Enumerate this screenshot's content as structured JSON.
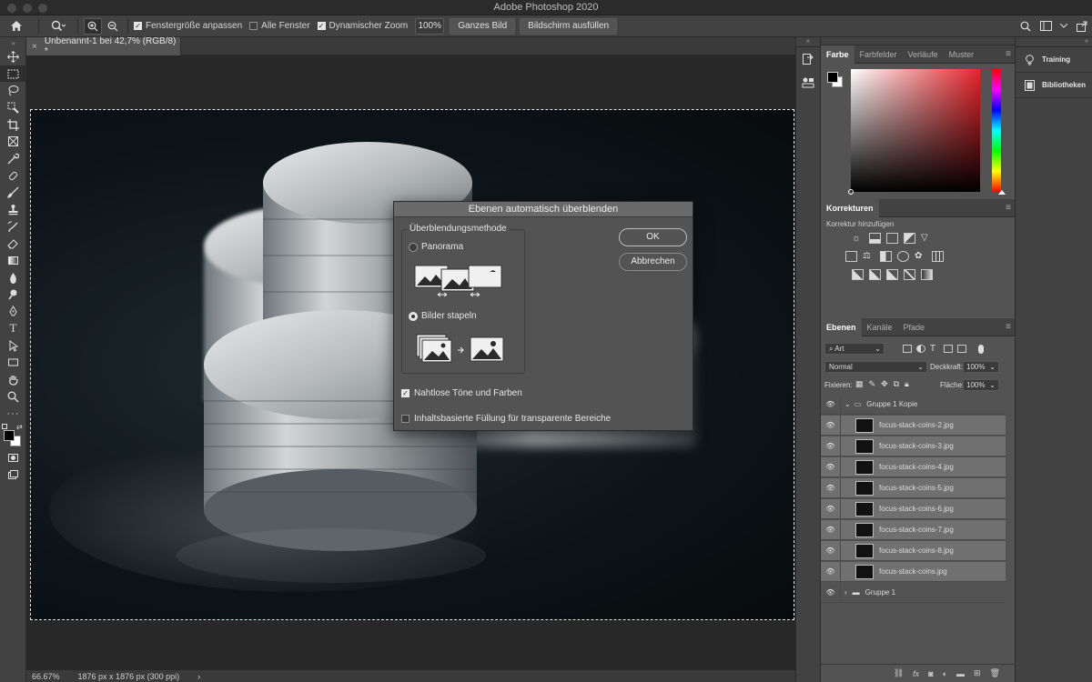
{
  "window": {
    "title": "Adobe Photoshop 2020"
  },
  "options": {
    "fit_window_label": "Fenstergröße anpassen",
    "all_windows_label": "Alle Fenster",
    "dynamic_zoom_label": "Dynamischer Zoom",
    "zoom_value": "100%",
    "whole_image_label": "Ganzes Bild",
    "fill_screen_label": "Bildschirm ausfüllen"
  },
  "document": {
    "tab_title": "Unbenannt-1 bei 42,7% (RGB/8) *",
    "status_zoom": "66.67%",
    "status_info": "1876 px x 1876 px (300 ppi)"
  },
  "dialog": {
    "title": "Ebenen automatisch überblenden",
    "group_label": "Überblendungsmethode",
    "option_panorama": "Panorama",
    "option_stack": "Bilder stapeln",
    "selected": "Bilder stapeln",
    "ok_label": "OK",
    "cancel_label": "Abbrechen",
    "seamless_label": "Nahtlose Töne und Farben",
    "seamless_checked": true,
    "content_aware_label": "Inhaltsbasierte Füllung für transparente Bereiche",
    "content_aware_checked": false
  },
  "color_panel": {
    "tabs": [
      "Farbe",
      "Farbfelder",
      "Verläufe",
      "Muster"
    ],
    "foreground": "#000000",
    "background": "#ffffff",
    "hue_color": "#e7242b"
  },
  "adjustments_panel": {
    "tab": "Korrekturen",
    "label": "Korrektur hinzufügen"
  },
  "layers_panel": {
    "tabs": [
      "Ebenen",
      "Kanäle",
      "Pfade"
    ],
    "filter_label": "Art",
    "blend_mode": "Normal",
    "opacity_label": "Deckkraft:",
    "opacity_value": "100%",
    "lock_label": "Fixieren:",
    "fill_label": "Fläche:",
    "fill_value": "100%",
    "group_copy": "Gruppe 1 Kopie",
    "group": "Gruppe 1",
    "layers": [
      "focus-stack-coins-2.jpg",
      "focus-stack-coins-3.jpg",
      "focus-stack-coins-4.jpg",
      "focus-stack-coins-5.jpg",
      "focus-stack-coins-6.jpg",
      "focus-stack-coins-7.jpg",
      "focus-stack-coins-8.jpg",
      "focus-stack-coins.jpg"
    ]
  },
  "right_panel": {
    "training_label": "Training",
    "libraries_label": "Bibliotheken"
  }
}
